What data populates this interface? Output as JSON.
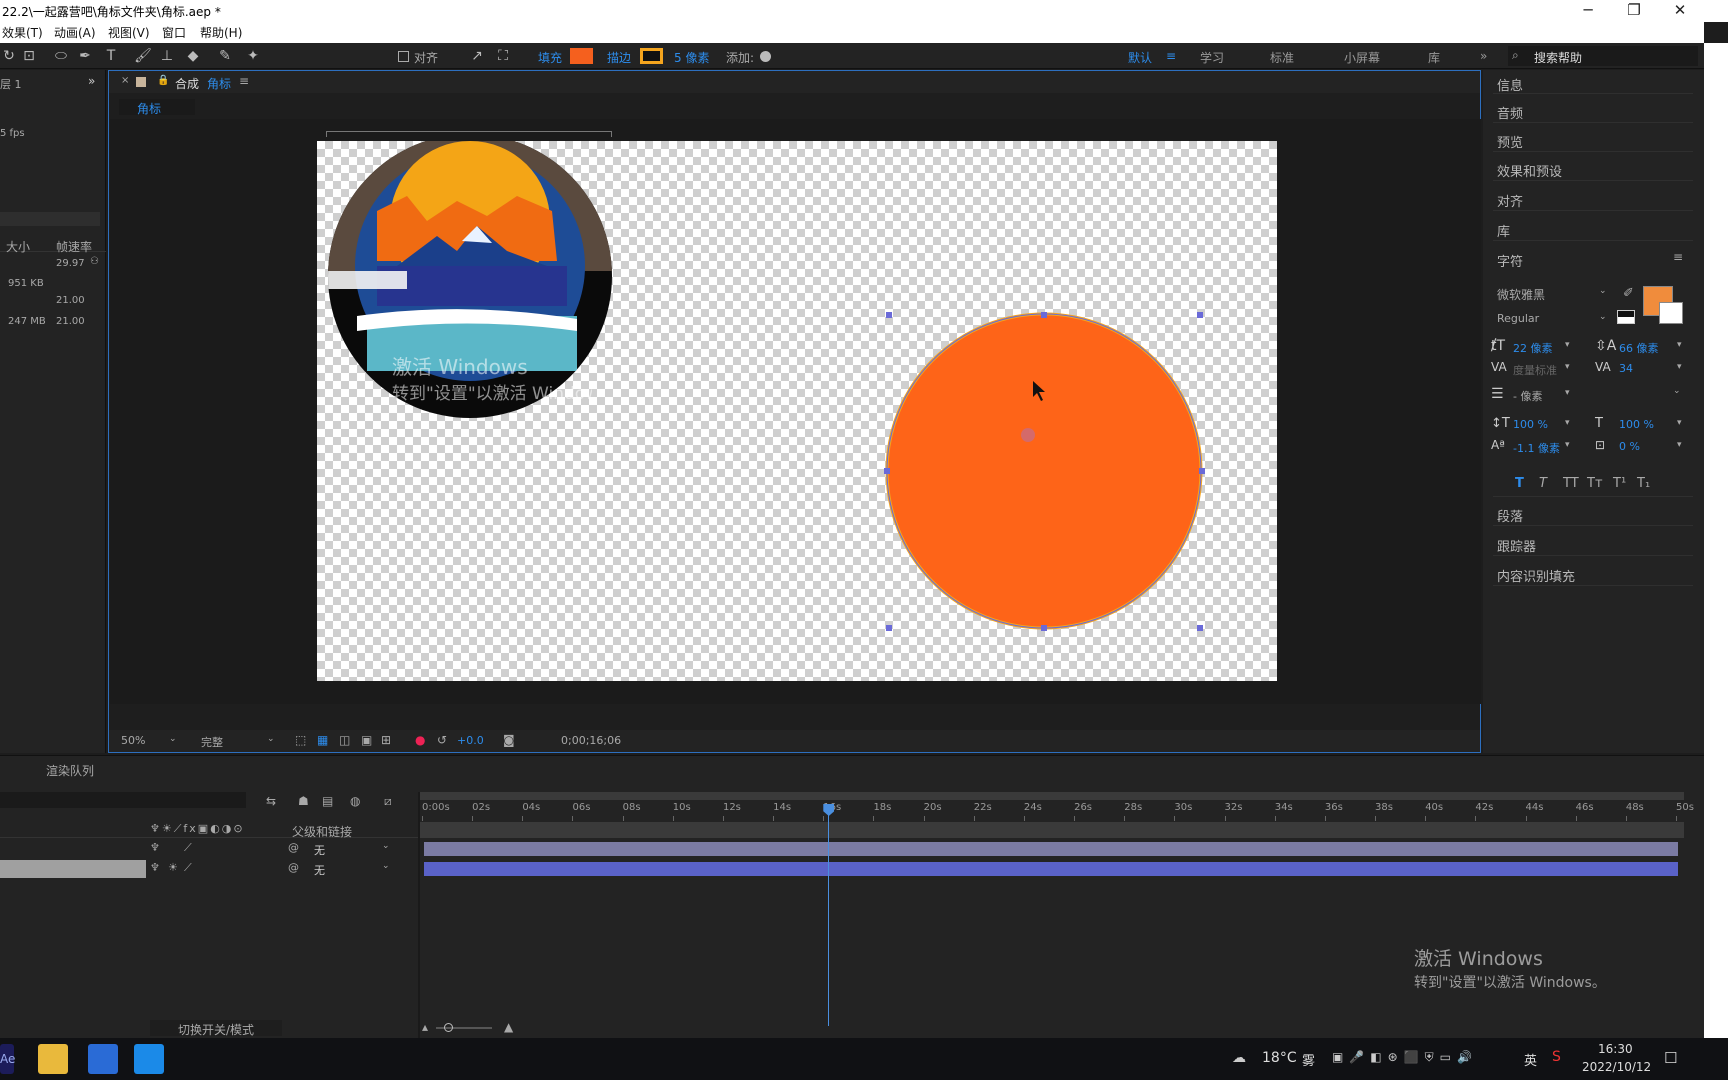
{
  "window": {
    "title": "22.2\\一起露营吧\\角标文件夹\\角标.aep *",
    "min_icon": "minimize-icon",
    "max_icon": "restore-icon",
    "close_icon": "close-icon"
  },
  "menu": [
    "效果(T)",
    "动画(A)",
    "视图(V)",
    "窗口",
    "帮助(H)"
  ],
  "toolbar": {
    "align_label": "对齐",
    "fill_label": "填充",
    "fill_color": "#f5601e",
    "stroke_label": "描边",
    "stroke_color": "#f5a51e",
    "stroke_size": "5 像素",
    "add_label": "添加:",
    "workspaces": [
      "默认",
      "学习",
      "标准",
      "小屏幕",
      "库"
    ],
    "more": "»",
    "search_placeholder": "搜索帮助"
  },
  "left_panel": {
    "layer_label": "层 1",
    "fps": "5 fps",
    "col_size": "大小",
    "col_fps": "帧速率",
    "rows": [
      {
        "size": "",
        "fps": "29.97"
      },
      {
        "size": "951 KB",
        "fps": ""
      },
      {
        "size": "",
        "fps": "21.00"
      },
      {
        "size": "247 MB",
        "fps": "21.00"
      }
    ]
  },
  "composition": {
    "tab_prefix": "合成",
    "tab_name": "角标",
    "breadcrumb": "角标",
    "zoom": "50%",
    "quality": "完整",
    "exposure": "+0.0",
    "timecode": "0;00;16;06",
    "watermark_line1": "激活 Windows",
    "watermark_line2": "转到\"设置\"以激活 Windows。",
    "shape_fill": "#f5601e",
    "shape_stroke": "#f5a51e"
  },
  "right_panel": {
    "items_top": [
      "信息",
      "音频",
      "预览",
      "效果和预设",
      "对齐",
      "库",
      "字符"
    ],
    "font_family": "微软雅黑",
    "font_style": "Regular",
    "font_size": "22 像素",
    "leading": "66 像素",
    "kerning": "度量标准",
    "tracking": "34",
    "stroke_width": "- 像素",
    "vscale": "100 %",
    "hscale": "100 %",
    "baseline": "-1.1 像素",
    "tsume": "0 %",
    "text_styles": [
      "T",
      "T",
      "TT",
      "Tт",
      "T¹",
      "T₁"
    ],
    "items_bottom": [
      "段落",
      "跟踪器",
      "内容识别填充"
    ],
    "char_color": "#f08c3c"
  },
  "timeline": {
    "render_queue": "渲染队列",
    "parent_col": "父级和链接",
    "layers": [
      {
        "parent": "无"
      },
      {
        "parent": "无"
      }
    ],
    "ticks": [
      "0:00s",
      "02s",
      "04s",
      "06s",
      "08s",
      "10s",
      "12s",
      "14s",
      "16s",
      "18s",
      "20s",
      "22s",
      "24s",
      "26s",
      "28s",
      "30s",
      "32s",
      "34s",
      "36s",
      "38s",
      "40s",
      "42s",
      "44s",
      "46s",
      "48s",
      "50s"
    ],
    "playhead_seconds": 16.2,
    "duration_seconds": 50,
    "switches_label": "切换开关/模式",
    "watermark_line1": "激活 Windows",
    "watermark_line2": "转到\"设置\"以激活 Windows。"
  },
  "taskbar": {
    "apps": [
      "Ae",
      "file-explorer",
      "photos",
      "app-blue"
    ],
    "weather": "18°C",
    "weather_desc": "雾",
    "ime": "英",
    "time": "16:30",
    "date": "2022/10/12"
  }
}
